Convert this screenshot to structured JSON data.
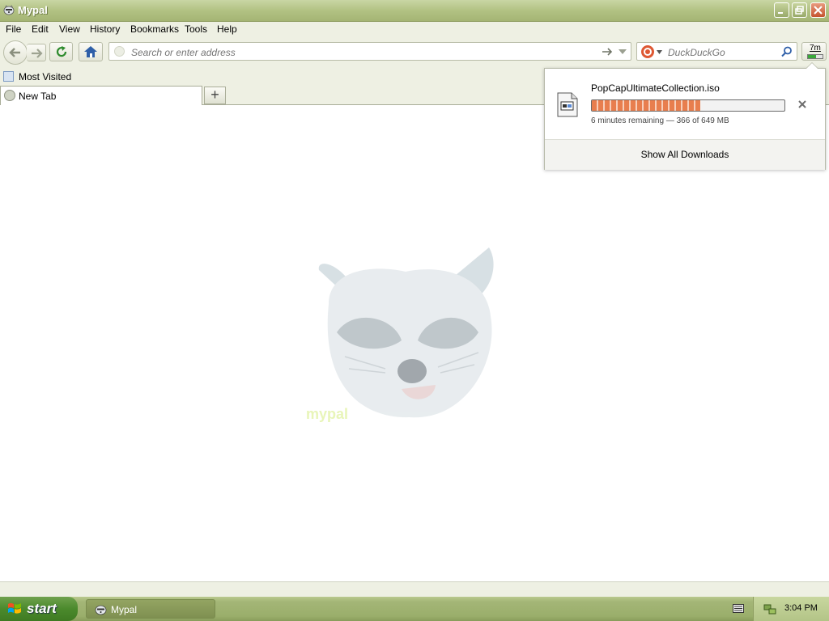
{
  "window": {
    "title": "Mypal"
  },
  "menubar": {
    "items": [
      {
        "label": "File"
      },
      {
        "label": "Edit"
      },
      {
        "label": "View"
      },
      {
        "label": "History"
      },
      {
        "label": "Bookmarks"
      },
      {
        "label": "Tools"
      },
      {
        "label": "Help"
      }
    ]
  },
  "navbar": {
    "url_placeholder": "Search or enter address",
    "search_placeholder": "DuckDuckGo",
    "download_button_label": "7m",
    "download_progress": 0.56
  },
  "bookmarks": {
    "items": [
      {
        "label": "Most Visited",
        "icon": "bookmark-page-icon"
      }
    ]
  },
  "tabs": {
    "items": [
      {
        "label": "New Tab",
        "icon": "globe-icon"
      }
    ],
    "new_tab_icon": "plus-icon"
  },
  "downloads_panel": {
    "file_name": "PopCapUltimateCollection.iso",
    "status": "6 minutes remaining — 366 of 649 MB",
    "progress": 0.564,
    "footer_label": "Show All Downloads"
  },
  "logo": {
    "text": "mypal"
  },
  "taskbar": {
    "start_label": "start",
    "items": [
      {
        "label": "Mypal"
      }
    ],
    "clock": "3:04 PM"
  },
  "colors": {
    "chrome_bg": "#eef0e3",
    "titlebar": "#b2c283",
    "progress_orange": "#e87e4e",
    "taskbar": "#9aae6b",
    "start_green": "#4b8a2c"
  }
}
